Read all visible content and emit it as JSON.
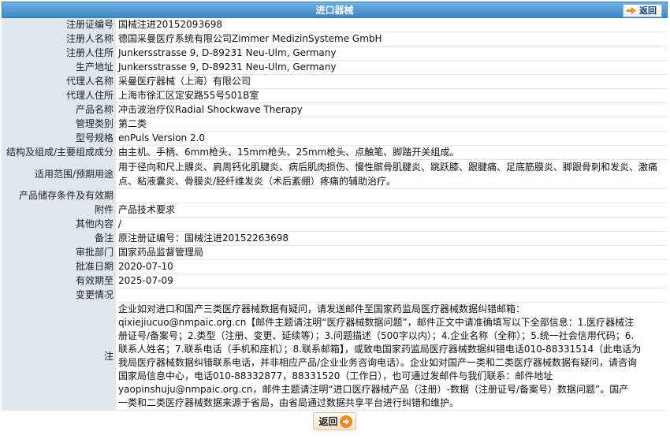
{
  "header": {
    "title": "进口器械",
    "back_label": "返回"
  },
  "rows": [
    {
      "label": "注册证编号",
      "value": "国械注进20152093698"
    },
    {
      "label": "注册人名称",
      "value": "德国采曼医疗系统有限公司Zimmer MedizinSysteme GmbH"
    },
    {
      "label": "注册人住所",
      "value": "Junkersstrasse 9, D-89231 Neu-Ulm, Germany"
    },
    {
      "label": "生产地址",
      "value": "Junkersstrasse 9, D-89231 Neu-Ulm, Germany"
    },
    {
      "label": "代理人名称",
      "value": "采曼医疗器械（上海）有限公司"
    },
    {
      "label": "代理人住所",
      "value": "上海市徐汇区定安路55号501B室"
    },
    {
      "label": "产品名称",
      "value": "冲击波治疗仪Radial Shockwave Therapy"
    },
    {
      "label": "管理类别",
      "value": "第二类"
    },
    {
      "label": "型号规格",
      "value": "enPuls Version 2.0"
    },
    {
      "label": "结构及组成/主要组成成分",
      "value": "由主机、手柄、6mm枪头、15mm枪头、25mm枪头、点触笔、脚踏开关组成。"
    }
  ],
  "scope": {
    "label": "适用范围/预期用途",
    "value": "用于径向和尺上髁炎、肩周钙化肌腱炎、病后肌肉损伤、慢性髌骨肌腱炎、跳跃膝、跟腱痛、足底筋膜炎、脚跟骨刺和发炎、激痛点、粘液囊炎、骨膜炎/胫纤维发炎（术后紊绷）疼痛的辅助治疗。"
  },
  "rows2": [
    {
      "label": "产品储存条件及有效期",
      "value": ""
    },
    {
      "label": "附件",
      "value": "产品技术要求"
    },
    {
      "label": "其他内容",
      "value": "/"
    },
    {
      "label": "备注",
      "value": "原注册证编号：国械注进20152263698"
    },
    {
      "label": "审批部门",
      "value": "国家药品监督管理局"
    },
    {
      "label": "批准日期",
      "value": "2020-07-10"
    },
    {
      "label": "有效期至",
      "value": "2025-07-09"
    },
    {
      "label": "变更情况",
      "value": ""
    }
  ],
  "note": {
    "label": "注",
    "lines": [
      "企业如对进口和国产三类医疗器械数据有疑问，请发送邮件至国家药监局医疗器械数据纠错邮箱：",
      "qixiejiucuo@nmpaic.org.cn【邮件主题请注明“医疗器械数据问题”，邮件正文中请准确填写以下全部信息：1.医疗器械注",
      "册证号/备案号；2.类型（注册、变更、延续等）；3.问题描述（500字以内）；4.企业名称（全称）；5.统一社会信用代码；6.",
      "联系人姓名；7.联系电话（手机和座机）；8.联系邮箱】，或致电国家药监局医疗器械数据纠错电话010-88331514（此电话为",
      "我局医疗器械数据纠错联系电话，并非相应产品/企业业务咨询电话）。企业如对国产一类和二类医疗器械数据有疑问，请咨询",
      "国家局信息中心，电话010-88332877，88331520（工作日），也可通过发邮件与我们联系：邮件地址",
      "yaopinshuju@nmpaic.org.cn，邮件主题请注明“进口医疗器械产品（注册）-数据（注册证号/备案号）数据问题”。国产",
      "一类和二类医疗器械数据来源于省局，由省局通过数据共享平台进行纠错和维护。"
    ]
  },
  "footer": {
    "back_label": "返回"
  },
  "colors": {
    "title_bar": "#4a90d0",
    "label_bg": "#dfe7ee",
    "back_icon": "#f08a1c"
  }
}
